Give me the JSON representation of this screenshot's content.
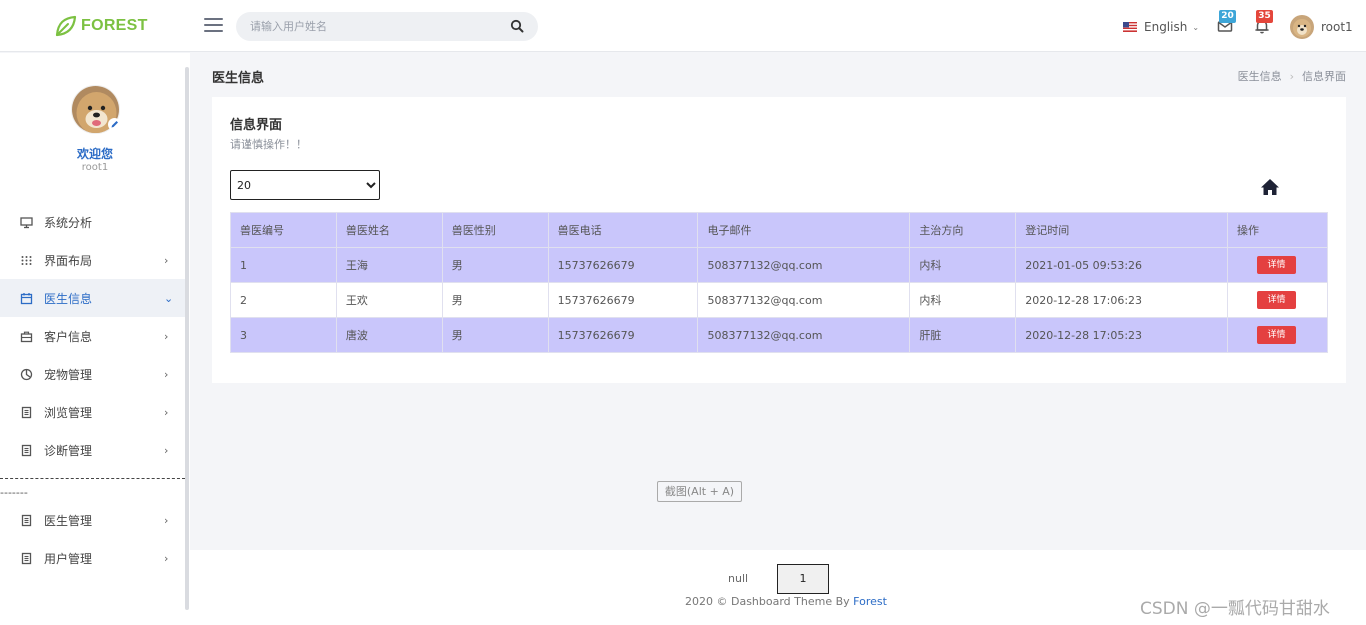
{
  "header": {
    "logo_text": "FOREST",
    "search_placeholder": "请输入用户姓名",
    "language": "English",
    "mail_count": "20",
    "notification_count": "35",
    "user_name": "root1",
    "colors": {
      "brand": "#7cc142",
      "badge_blue": "#3ea6d8",
      "badge_red": "#e4463b"
    }
  },
  "sidebar": {
    "welcome": "欢迎您",
    "user": "root1",
    "items": [
      {
        "label": "系统分析",
        "icon": "monitor-icon",
        "has_chevron": false
      },
      {
        "label": "界面布局",
        "icon": "grid-icon",
        "has_chevron": true
      },
      {
        "label": "医生信息",
        "icon": "calendar-icon",
        "has_chevron": true,
        "active": true
      },
      {
        "label": "客户信息",
        "icon": "briefcase-icon",
        "has_chevron": true
      },
      {
        "label": "宠物管理",
        "icon": "paw-icon",
        "has_chevron": true
      },
      {
        "label": "浏览管理",
        "icon": "document-icon",
        "has_chevron": true
      },
      {
        "label": "诊断管理",
        "icon": "document-icon",
        "has_chevron": true
      }
    ],
    "divider_text": "-------",
    "admin_items": [
      {
        "label": "医生管理",
        "icon": "document-icon",
        "has_chevron": true
      },
      {
        "label": "用户管理",
        "icon": "document-icon",
        "has_chevron": true
      }
    ]
  },
  "main": {
    "page_title": "医生信息",
    "breadcrumb": [
      "医生信息",
      "信息界面"
    ],
    "card_title": "信息界面",
    "card_subtitle": "请谨慎操作！！",
    "page_size": "20",
    "table": {
      "columns": [
        "兽医编号",
        "兽医姓名",
        "兽医性别",
        "兽医电话",
        "电子邮件",
        "主治方向",
        "登记时间",
        "操作"
      ],
      "rows": [
        [
          "1",
          "王海",
          "男",
          "15737626679",
          "508377132@qq.com",
          "内科",
          "2021-01-05 09:53:26"
        ],
        [
          "2",
          "王欢",
          "男",
          "15737626679",
          "508377132@qq.com",
          "内科",
          "2020-12-28 17:06:23"
        ],
        [
          "3",
          "唐波",
          "男",
          "15737626679",
          "508377132@qq.com",
          "肝脏",
          "2020-12-28 17:05:23"
        ]
      ],
      "action_label": "详情"
    },
    "screenshot_hint": "截图(Alt + A)"
  },
  "footer": {
    "pager_label": "null",
    "current_page": "1",
    "copyright_prefix": "2020 © Dashboard Theme By",
    "copyright_link": "Forest"
  },
  "watermark": "CSDN @一瓢代码甘甜水"
}
